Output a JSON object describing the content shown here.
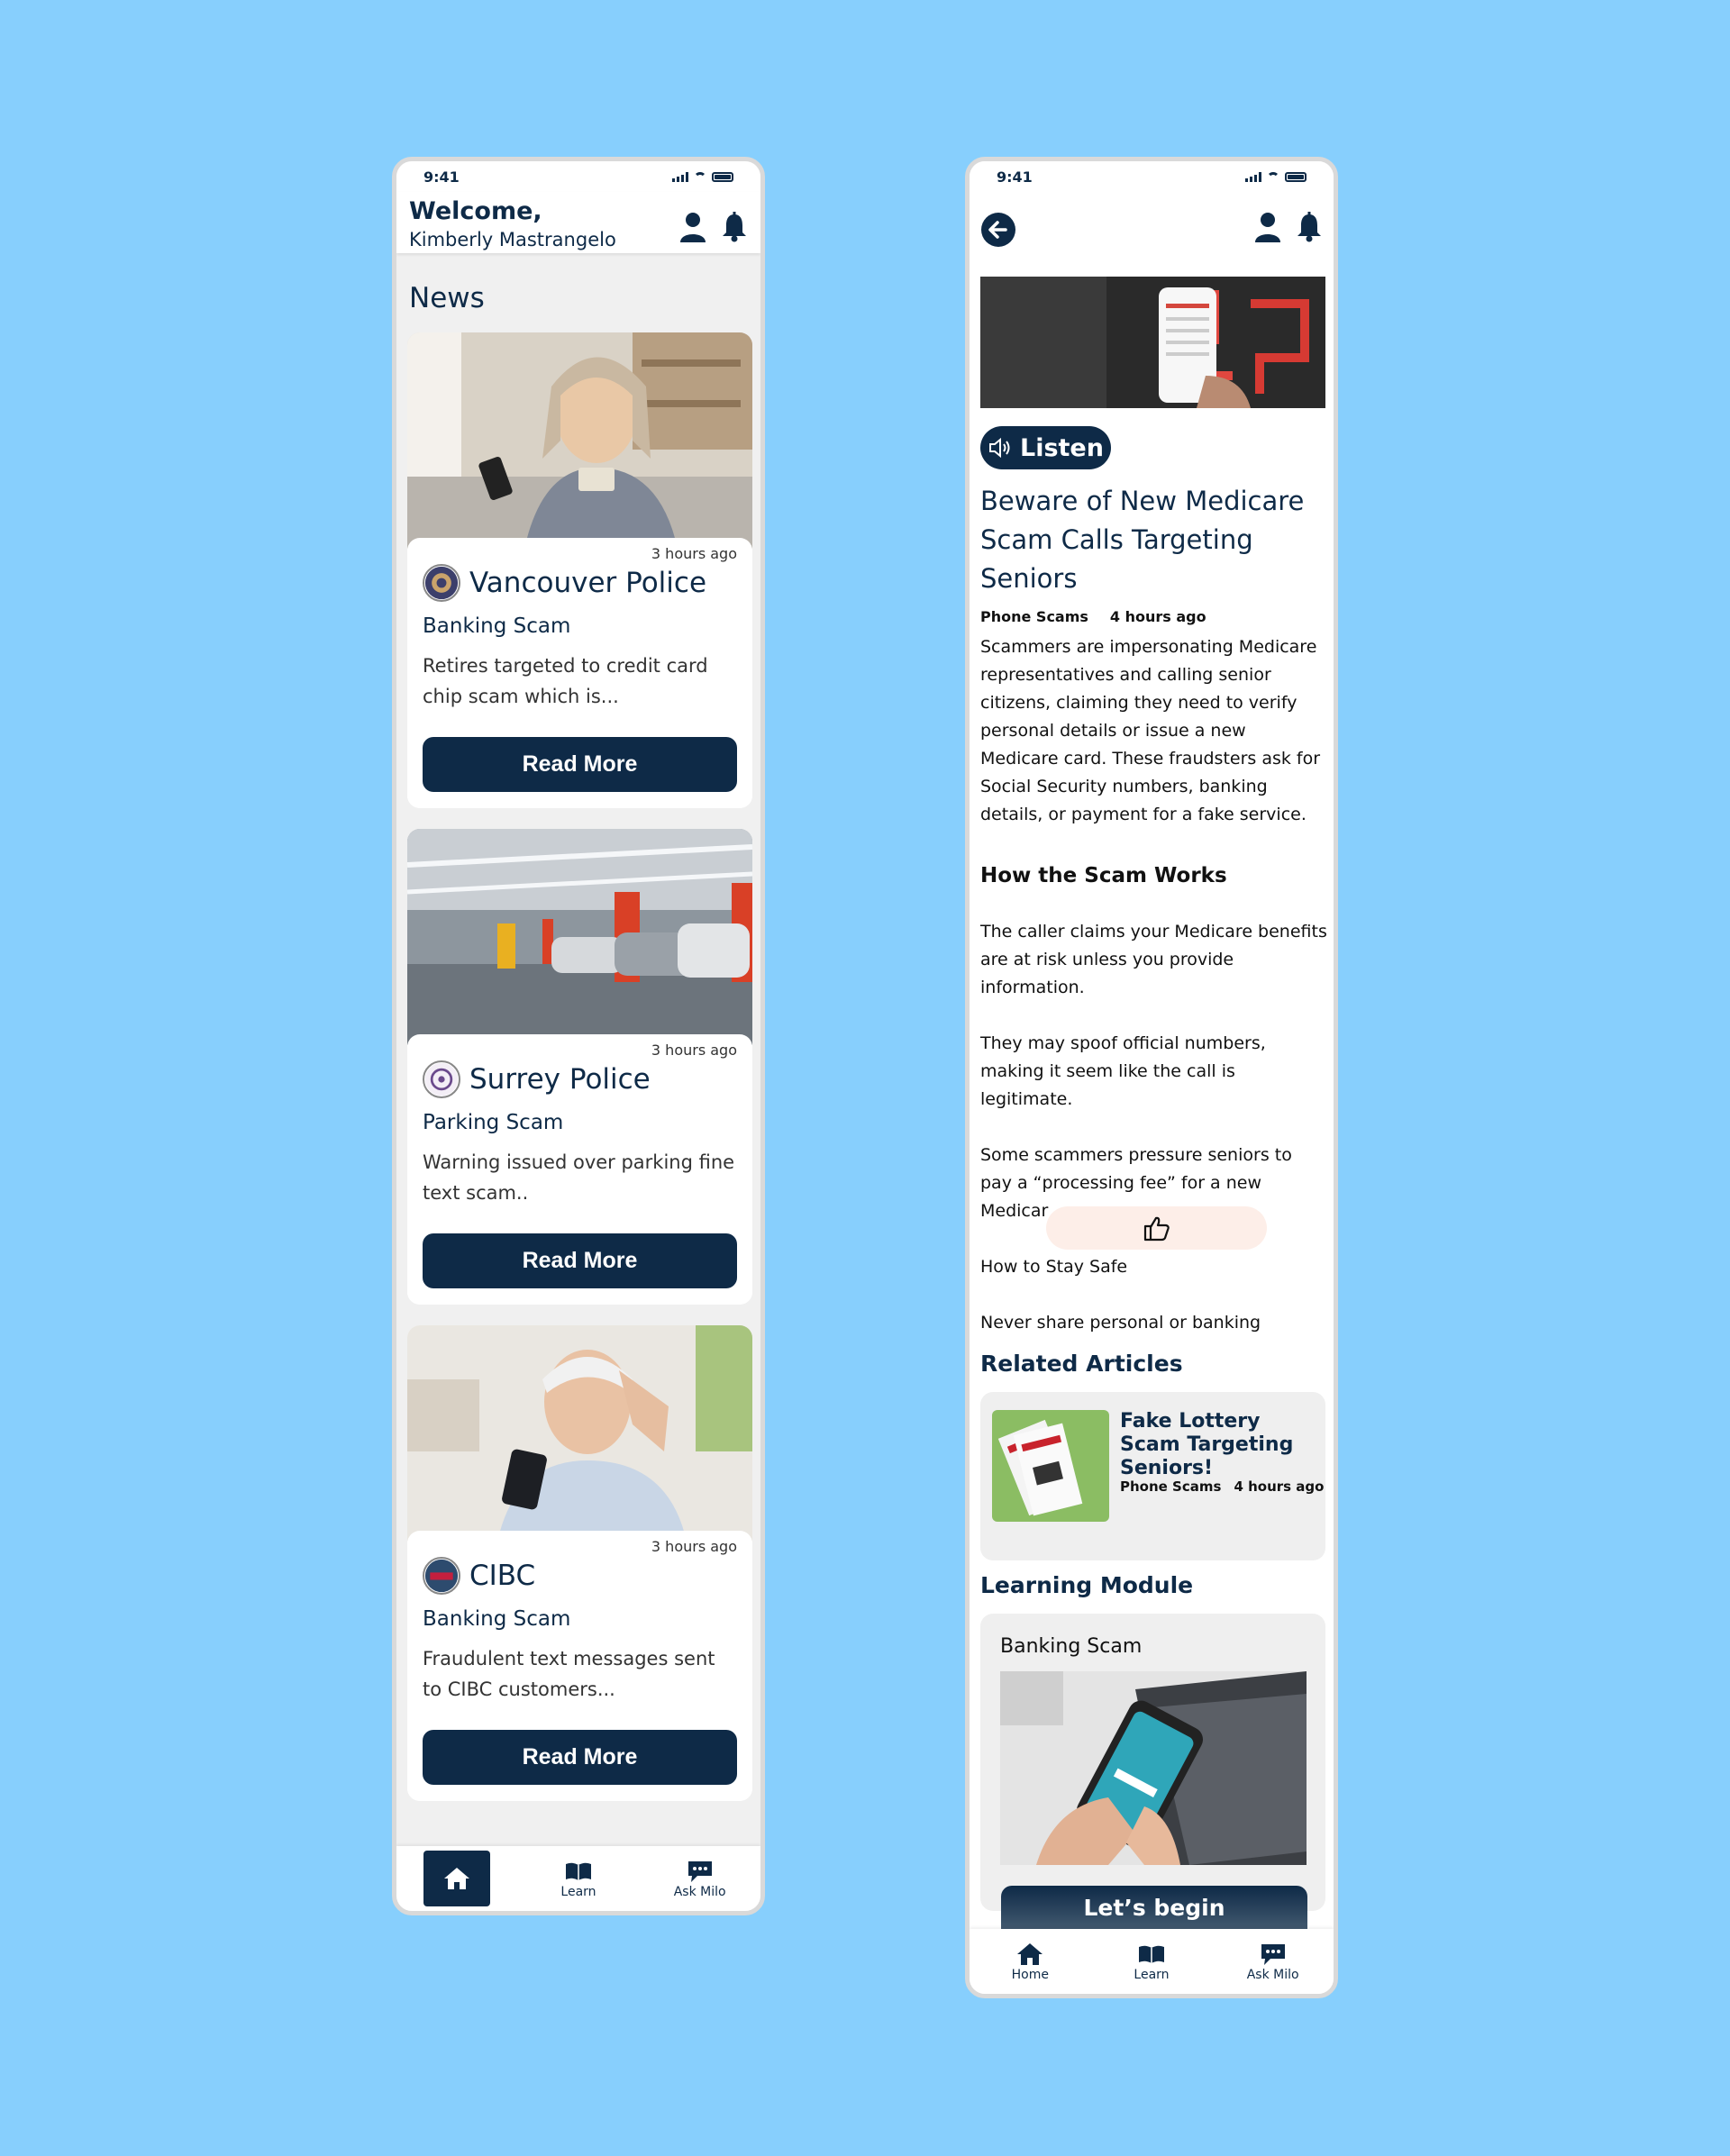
{
  "colors": {
    "background": "#87CFFD",
    "primary": "#0E2A47",
    "card": "#ffffff",
    "muted_surface": "#efefef",
    "like_pill": "#fdeee8"
  },
  "left_screen": {
    "status_time": "9:41",
    "welcome": "Welcome,",
    "user_name": "Kimberly Mastrangelo",
    "section_title": "News",
    "news": [
      {
        "time": "3 hours ago",
        "source": "Vancouver Police",
        "scam_type": "Banking Scam",
        "snippet": "Retires targeted to credit card chip scam which is...",
        "button": "Read More"
      },
      {
        "time": "3 hours ago",
        "source": "Surrey Police",
        "scam_type": "Parking Scam",
        "snippet": "Warning issued over parking fine text scam..",
        "button": "Read More"
      },
      {
        "time": "3 hours ago",
        "source": "CIBC",
        "scam_type": "Banking Scam",
        "snippet": "Fraudulent  text messages sent to CIBC customers...",
        "button": "Read More"
      }
    ],
    "tabs": [
      {
        "label": "",
        "icon": "home-icon",
        "active": true
      },
      {
        "label": "Learn",
        "icon": "book-icon",
        "active": false
      },
      {
        "label": "Ask Milo",
        "icon": "chat-icon",
        "active": false
      }
    ]
  },
  "right_screen": {
    "status_time": "9:41",
    "listen_label": "Listen",
    "title": "Beware of New Medicare Scam Calls Targeting Seniors",
    "category": "Phone Scams",
    "time": "4 hours ago",
    "intro": "Scammers are impersonating Medicare representatives and calling senior citizens, claiming they need to verify personal details or issue a new Medicare card. These fraudsters ask for Social Security numbers, banking details, or payment for a fake service.",
    "how_heading": "How the Scam Works",
    "para1": "The caller claims your Medicare benefits are at risk unless you provide information.",
    "para2": "They may spoof official numbers, making it seem like the call is legitimate.",
    "para3": "Some scammers pressure seniors to pay a “processing fee” for a new Medicar",
    "stay_safe": "How to Stay Safe",
    "never_share": "Never share personal or banking",
    "related_heading": "Related Articles",
    "related": {
      "title": "Fake Lottery Scam Targeting Seniors!",
      "category": "Phone Scams",
      "time": "4 hours ago"
    },
    "learning_heading": "Learning Module",
    "learning": {
      "title": "Banking Scam",
      "button": "Let’s begin"
    },
    "tabs": [
      {
        "label": "Home",
        "icon": "home-icon"
      },
      {
        "label": "Learn",
        "icon": "book-icon"
      },
      {
        "label": "Ask Milo",
        "icon": "chat-icon"
      }
    ]
  }
}
